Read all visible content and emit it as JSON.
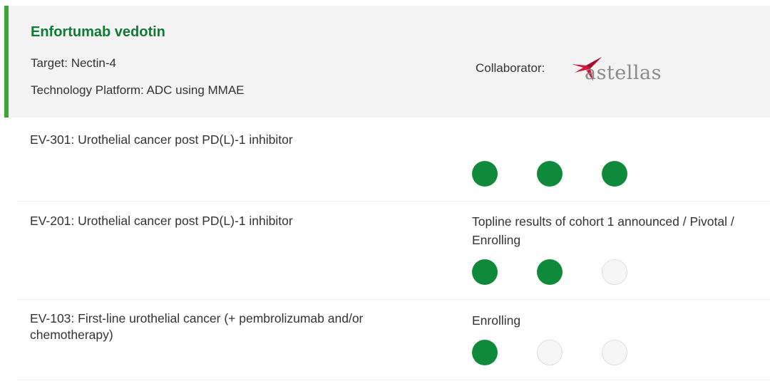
{
  "program": {
    "drug_name": "Enfortumab vedotin",
    "target": "Target: Nectin-4",
    "platform": "Technology Platform: ADC using MMAE",
    "collaborator_label": "Collaborator:",
    "collaborator_logo_text": "astellas",
    "accent_color": "#3aa535",
    "title_color": "#0f7a34"
  },
  "trials": [
    {
      "name": "EV-301: Urothelial cancer post PD(L)-1 inhibitor",
      "status": "",
      "phases": [
        true,
        true,
        true
      ]
    },
    {
      "name": "EV-201: Urothelial cancer post PD(L)-1 inhibitor",
      "status": "Topline results of cohort 1 announced / Pivotal / Enrolling",
      "phases": [
        true,
        true,
        false
      ]
    },
    {
      "name": "EV-103: First-line urothelial cancer (+ pembrolizumab and/or chemotherapy)",
      "status": "Enrolling",
      "phases": [
        true,
        false,
        false
      ]
    }
  ],
  "colors": {
    "phase_filled": "#0e8a3a",
    "phase_empty": "#f6f6f6"
  }
}
